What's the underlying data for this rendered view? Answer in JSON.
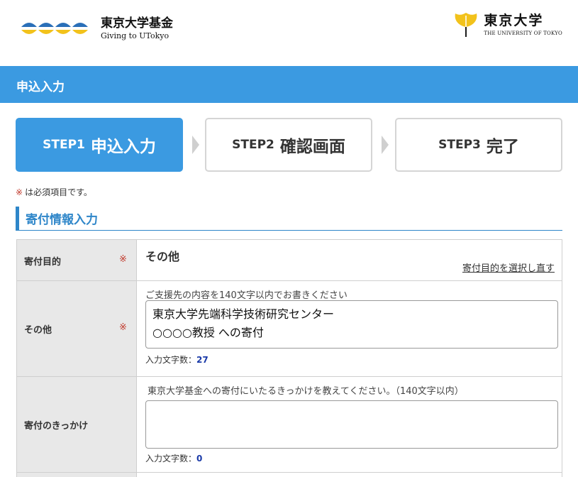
{
  "header": {
    "logo_left": {
      "jp": "東京大学基金",
      "en": "Giving to UTokyo"
    },
    "logo_right": {
      "jp": "東京大学",
      "en": "THE UNIVERSITY OF TOKYO"
    }
  },
  "page_title": "申込入力",
  "steps": [
    {
      "num": "STEP1",
      "label": "申込入力",
      "active": true
    },
    {
      "num": "STEP2",
      "label": "確認画面",
      "active": false
    },
    {
      "num": "STEP3",
      "label": "完了",
      "active": false
    }
  ],
  "required_note": {
    "mark": "※",
    "text": "は必須項目です。"
  },
  "section_title": "寄付情報入力",
  "form": {
    "purpose": {
      "label": "寄付目的",
      "required_mark": "※",
      "value": "その他",
      "reselect_link": "寄付目的を選択し直す"
    },
    "other": {
      "label": "その他",
      "required_mark": "※",
      "hint": "ご支援先の内容を140文字以内でお書きください",
      "value": "東京大学先端科学技術研究センター\n○○○○教授 への寄付",
      "count_label": "入力文字数：",
      "count": "27"
    },
    "reason": {
      "label": "寄付のきっかけ",
      "hint": "東京大学基金への寄付にいたるきっかけを教えてください。（140文字以内）",
      "value": "",
      "count_label": "入力文字数：",
      "count": "0"
    }
  },
  "colors": {
    "accent": "#3b9ae1",
    "section": "#2e86c9",
    "required": "#c0392b",
    "count": "#1a3aa8"
  }
}
